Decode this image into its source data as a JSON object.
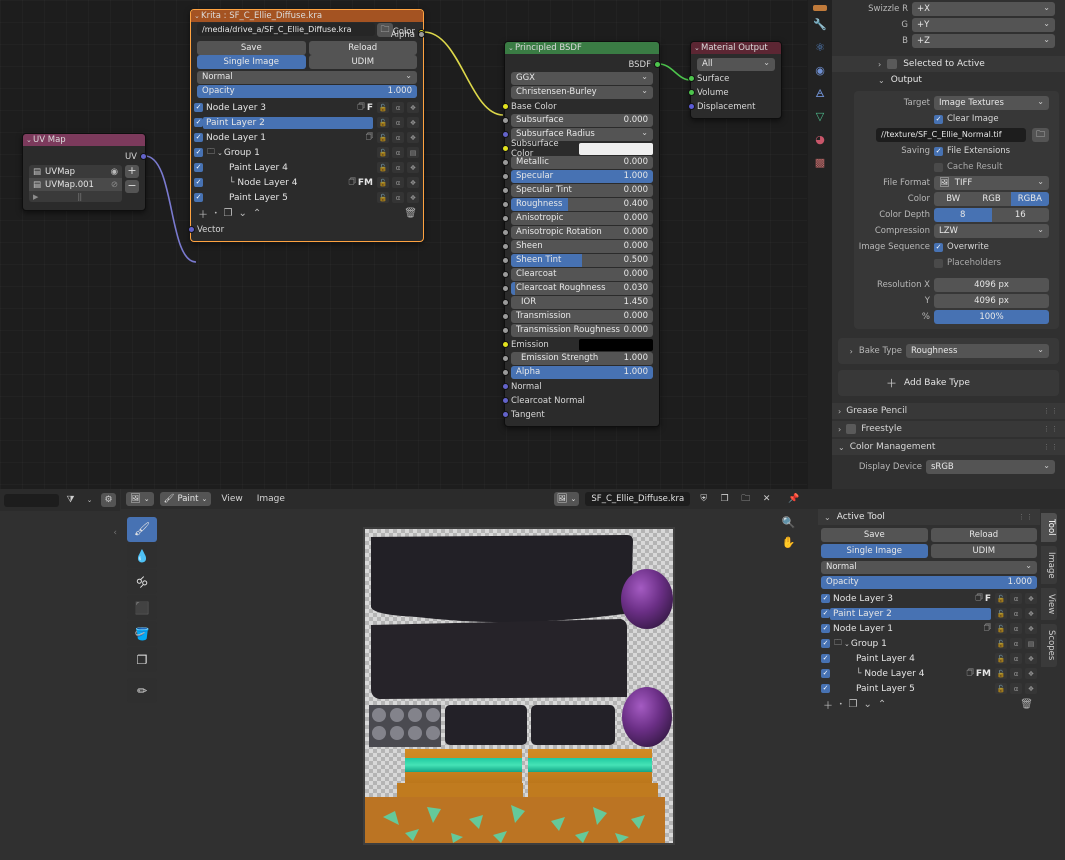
{
  "node_editor": {
    "nodes": {
      "uvmap": {
        "title": "UV Map",
        "output_socket": "UV",
        "items": [
          {
            "label": "UVMap",
            "icon": "camera-icon"
          },
          {
            "label": "UVMap.001",
            "icon": "camera-off-icon"
          }
        ],
        "add_button": "+",
        "remove_button": "−"
      },
      "krita": {
        "title": "Krita : SF_C_Ellie_Diffuse.kra",
        "filepath": "/media/drive_a/SF_C_Ellie_Diffuse.kra",
        "out_sockets": [
          "Color",
          "Alpha"
        ],
        "save_label": "Save",
        "reload_label": "Reload",
        "single_image_label": "Single Image",
        "udim_label": "UDIM",
        "blend_mode": "Normal",
        "opacity_label": "Opacity",
        "opacity_value": "1.000",
        "layers": [
          {
            "name": "Node Layer 3",
            "checked": true,
            "indent": 0,
            "badges": "F",
            "node_icon": true,
            "highlight": false
          },
          {
            "name": "Paint Layer 2",
            "checked": true,
            "indent": 0,
            "badges": "",
            "node_icon": false,
            "highlight": true
          },
          {
            "name": "Node Layer 1",
            "checked": true,
            "indent": 0,
            "badges": "",
            "node_icon": true,
            "highlight": false
          },
          {
            "name": "Group 1",
            "checked": true,
            "indent": 0,
            "badges": "",
            "node_icon": false,
            "highlight": false,
            "group": true
          },
          {
            "name": "Paint Layer 4",
            "checked": true,
            "indent": 1,
            "badges": "",
            "node_icon": false,
            "highlight": false
          },
          {
            "name": "Node Layer 4",
            "checked": true,
            "indent": 2,
            "badges": "FM",
            "node_icon": true,
            "highlight": false,
            "branch": true
          },
          {
            "name": "Paint Layer 5",
            "checked": true,
            "indent": 1,
            "badges": "",
            "node_icon": false,
            "highlight": false
          }
        ],
        "footer_icons": [
          "add-icon",
          "dot-icon",
          "duplicate-icon",
          "move-down-icon",
          "move-up-icon",
          "trash-icon"
        ],
        "input_socket": "Vector"
      },
      "principled": {
        "title": "Principled BSDF",
        "output_socket": "BSDF",
        "distribution": "GGX",
        "subsurface_method": "Christensen-Burley",
        "inputs": [
          {
            "label": "Base Color",
            "type": "color_socket",
            "socket": "yellow"
          },
          {
            "label": "Subsurface",
            "type": "value",
            "value": "0.000",
            "fill": 0,
            "socket": "grey"
          },
          {
            "label": "Subsurface Radius",
            "type": "dropdown",
            "socket": "purple"
          },
          {
            "label": "Subsurface Color",
            "type": "swatch",
            "swatch": "#efefef",
            "socket": "yellow"
          },
          {
            "label": "Metallic",
            "type": "value",
            "value": "0.000",
            "fill": 0,
            "socket": "grey"
          },
          {
            "label": "Specular",
            "type": "value",
            "value": "1.000",
            "fill": 100,
            "socket": "grey"
          },
          {
            "label": "Specular Tint",
            "type": "value",
            "value": "0.000",
            "fill": 0,
            "socket": "grey"
          },
          {
            "label": "Roughness",
            "type": "value",
            "value": "0.400",
            "fill": 40,
            "socket": "grey"
          },
          {
            "label": "Anisotropic",
            "type": "value",
            "value": "0.000",
            "fill": 0,
            "socket": "grey"
          },
          {
            "label": "Anisotropic Rotation",
            "type": "value",
            "value": "0.000",
            "fill": 0,
            "socket": "grey"
          },
          {
            "label": "Sheen",
            "type": "value",
            "value": "0.000",
            "fill": 0,
            "socket": "grey"
          },
          {
            "label": "Sheen Tint",
            "type": "value",
            "value": "0.500",
            "fill": 50,
            "socket": "grey"
          },
          {
            "label": "Clearcoat",
            "type": "value",
            "value": "0.000",
            "fill": 0,
            "socket": "grey"
          },
          {
            "label": "Clearcoat Roughness",
            "type": "value",
            "value": "0.030",
            "fill": 3,
            "socket": "grey"
          },
          {
            "label": "IOR",
            "type": "value",
            "value": "1.450",
            "fill": 0,
            "socket": "grey"
          },
          {
            "label": "Transmission",
            "type": "value",
            "value": "0.000",
            "fill": 0,
            "socket": "grey"
          },
          {
            "label": "Transmission Roughness",
            "type": "value",
            "value": "0.000",
            "fill": 0,
            "socket": "grey"
          },
          {
            "label": "Emission",
            "type": "swatch",
            "swatch": "#000000",
            "socket": "yellow"
          },
          {
            "label": "Emission Strength",
            "type": "value",
            "value": "1.000",
            "fill": 0,
            "socket": "grey"
          },
          {
            "label": "Alpha",
            "type": "value",
            "value": "1.000",
            "fill": 100,
            "socket": "grey"
          },
          {
            "label": "Normal",
            "type": "socket_only",
            "socket": "purple"
          },
          {
            "label": "Clearcoat Normal",
            "type": "socket_only",
            "socket": "purple"
          },
          {
            "label": "Tangent",
            "type": "socket_only",
            "socket": "purple"
          }
        ]
      },
      "material_output": {
        "title": "Material Output",
        "target": "All",
        "inputs": [
          "Surface",
          "Volume",
          "Displacement"
        ]
      }
    }
  },
  "properties": {
    "swizzle": {
      "label_r": "Swizzle R",
      "value_r": "+X",
      "label_g": "G",
      "value_g": "+Y",
      "label_b": "B",
      "value_b": "+Z"
    },
    "selected_to_active": "Selected to Active",
    "output_header": "Output",
    "target_label": "Target",
    "target_value": "Image Textures",
    "clear_image": "Clear Image",
    "output_path": "//texture/SF_C_Ellie_Normal.tif",
    "saving_label": "Saving",
    "file_extensions": "File Extensions",
    "cache_result": "Cache Result",
    "file_format_label": "File Format",
    "file_format_value": "TIFF",
    "color_label": "Color",
    "color_options": [
      "BW",
      "RGB",
      "RGBA"
    ],
    "color_selected": "RGBA",
    "color_depth_label": "Color Depth",
    "color_depth_options": [
      "8",
      "16"
    ],
    "color_depth_selected": "8",
    "compression_label": "Compression",
    "compression_value": "LZW",
    "image_sequence_label": "Image Sequence",
    "overwrite": "Overwrite",
    "placeholders": "Placeholders",
    "resolution_x_label": "Resolution X",
    "resolution_x_value": "4096 px",
    "resolution_y_label": "Y",
    "resolution_y_value": "4096 px",
    "resolution_pct_label": "%",
    "resolution_pct_value": "100%",
    "bake_type_label": "Bake Type",
    "bake_type_value": "Roughness",
    "add_bake_type": "Add Bake Type",
    "grease_pencil": "Grease Pencil",
    "freestyle": "Freestyle",
    "color_management": "Color Management",
    "display_device_label": "Display Device",
    "display_device_value": "sRGB"
  },
  "image_editor": {
    "header": {
      "editor_type": "image-editor-icon",
      "mode": "Paint",
      "menus": [
        "View",
        "Image"
      ],
      "image_name": "SF_C_Ellie_Diffuse.kra",
      "datablock_icons": [
        "shield-icon",
        "copy-icon",
        "open-folder-icon",
        "close-x-icon",
        "pin-icon"
      ]
    },
    "outliner_header": {
      "search_placeholder": "",
      "filter_icon": "filter-icon",
      "settings_icon": "gear-icon"
    },
    "tools": [
      {
        "name": "draw-tool",
        "icon": "brush-icon",
        "active": true
      },
      {
        "name": "soften-tool",
        "icon": "droplet-icon",
        "active": false
      },
      {
        "name": "smear-tool",
        "icon": "smear-icon",
        "active": false
      },
      {
        "name": "clone-tool",
        "icon": "stamp-icon",
        "active": false
      },
      {
        "name": "fill-tool",
        "icon": "bucket-icon",
        "active": false
      },
      {
        "name": "mask-tool",
        "icon": "mask-icon",
        "active": false
      },
      {
        "name": "annotate-tool",
        "icon": "pencil-icon",
        "active": false
      }
    ],
    "nav_icons": [
      "zoom-icon",
      "pan-hand-icon"
    ],
    "sidebar_tabs": [
      {
        "label": "Tool",
        "active": true
      },
      {
        "label": "Image",
        "active": false
      },
      {
        "label": "View",
        "active": false
      },
      {
        "label": "Scopes",
        "active": false
      }
    ],
    "active_tool_panel": {
      "title": "Active Tool",
      "save_label": "Save",
      "reload_label": "Reload",
      "single_image_label": "Single Image",
      "udim_label": "UDIM",
      "blend_mode": "Normal",
      "opacity_label": "Opacity",
      "opacity_value": "1.000",
      "layers": [
        {
          "name": "Node Layer 3",
          "checked": true,
          "indent": 0,
          "badges": "F",
          "node_icon": true,
          "highlight": false
        },
        {
          "name": "Paint Layer 2",
          "checked": true,
          "indent": 0,
          "badges": "",
          "node_icon": false,
          "highlight": true
        },
        {
          "name": "Node Layer 1",
          "checked": true,
          "indent": 0,
          "badges": "",
          "node_icon": true,
          "highlight": false
        },
        {
          "name": "Group 1",
          "checked": true,
          "indent": 0,
          "badges": "",
          "node_icon": false,
          "highlight": false,
          "group": true
        },
        {
          "name": "Paint Layer 4",
          "checked": true,
          "indent": 1,
          "badges": "",
          "node_icon": false,
          "highlight": false
        },
        {
          "name": "Node Layer 4",
          "checked": true,
          "indent": 2,
          "badges": "FM",
          "node_icon": true,
          "highlight": false,
          "branch": true
        },
        {
          "name": "Paint Layer 5",
          "checked": true,
          "indent": 1,
          "badges": "",
          "node_icon": false,
          "highlight": false
        }
      ]
    }
  },
  "colors": {
    "accent_blue": "#4772b3",
    "node_header_krita": "#a45322",
    "node_header_bsdf": "#3a7c44",
    "node_header_output": "#5c2633",
    "node_header_input": "#7c3a5c",
    "bg_dark": "#1d1d1d",
    "panel_bg": "#303030"
  }
}
